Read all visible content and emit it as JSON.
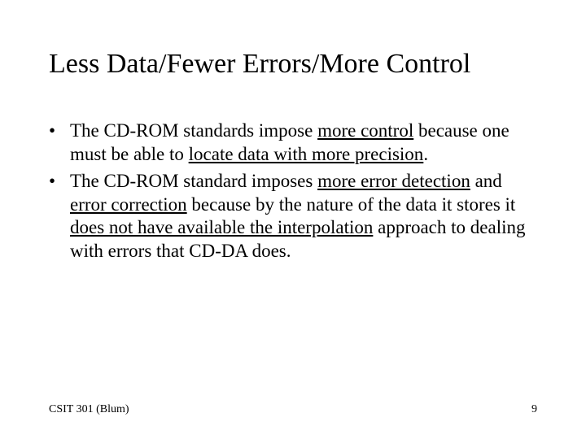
{
  "title": "Less Data/Fewer Errors/More Control",
  "bullets": [
    {
      "t1": "The CD-ROM standards impose ",
      "u1": "more control",
      "t2": " because one must be able to ",
      "u2": "locate data with more precision",
      "t3": "."
    },
    {
      "t1": "The CD-ROM standard imposes ",
      "u1": "more error detection",
      "t2": " and ",
      "u2": "error correction",
      "t3": " because by the nature of the data it stores it ",
      "u3": "does not have available the interpolation",
      "t4": " approach to dealing with errors that CD-DA does."
    }
  ],
  "footer_left": "CSIT 301 (Blum)",
  "footer_right": "9",
  "bullet_glyph": "•"
}
